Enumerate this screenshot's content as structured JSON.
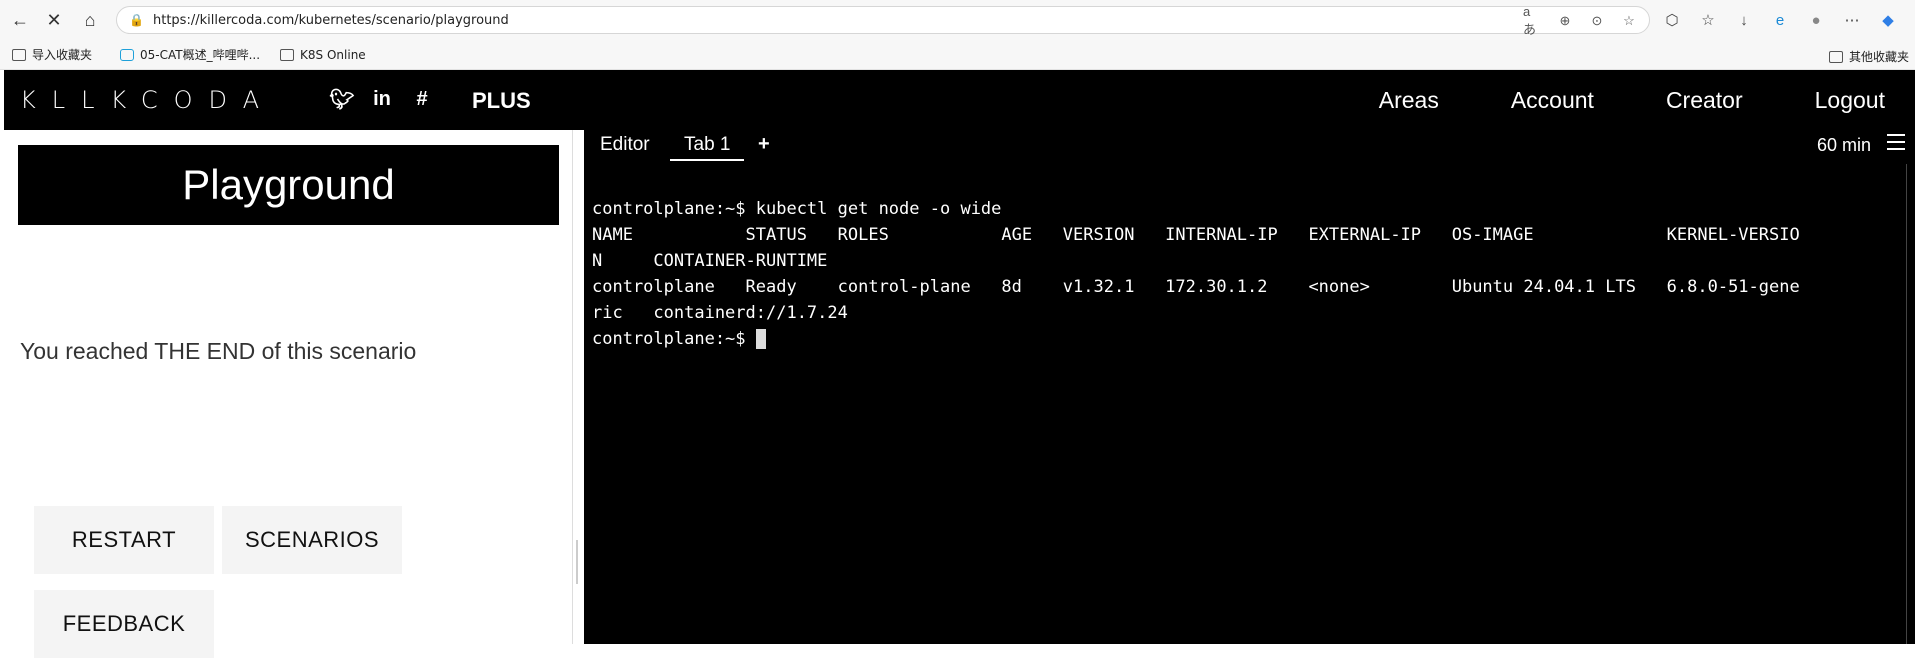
{
  "browser": {
    "url": "https://killercoda.com/kubernetes/scenario/playground",
    "bookmarks": [
      {
        "label": "导入收藏夹"
      },
      {
        "label": "05-CAT概述_哔哩哔..."
      },
      {
        "label": "K8S Online"
      }
    ],
    "other_bookmarks": "其他收藏夹"
  },
  "site": {
    "logo": "KLLKCODA",
    "plus": "PLUS",
    "nav": [
      "Areas",
      "Account",
      "Creator",
      "Logout"
    ]
  },
  "left": {
    "title": "Playground",
    "end_text": "You reached THE END of this scenario",
    "buttons": {
      "restart": "RESTART",
      "scenarios": "SCENARIOS",
      "feedback": "FEEDBACK"
    }
  },
  "terminal": {
    "tabs": {
      "editor": "Editor",
      "tab1": "Tab 1",
      "add": "+"
    },
    "timer": "60 min",
    "lines": [
      "controlplane:~$ kubectl get node -o wide",
      "NAME           STATUS   ROLES           AGE   VERSION   INTERNAL-IP   EXTERNAL-IP   OS-IMAGE             KERNEL-VERSIO",
      "N     CONTAINER-RUNTIME",
      "controlplane   Ready    control-plane   8d    v1.32.1   172.30.1.2    <none>        Ubuntu 24.04.1 LTS   6.8.0-51-gene",
      "ric   containerd://1.7.24"
    ],
    "prompt": "controlplane:~$ "
  }
}
